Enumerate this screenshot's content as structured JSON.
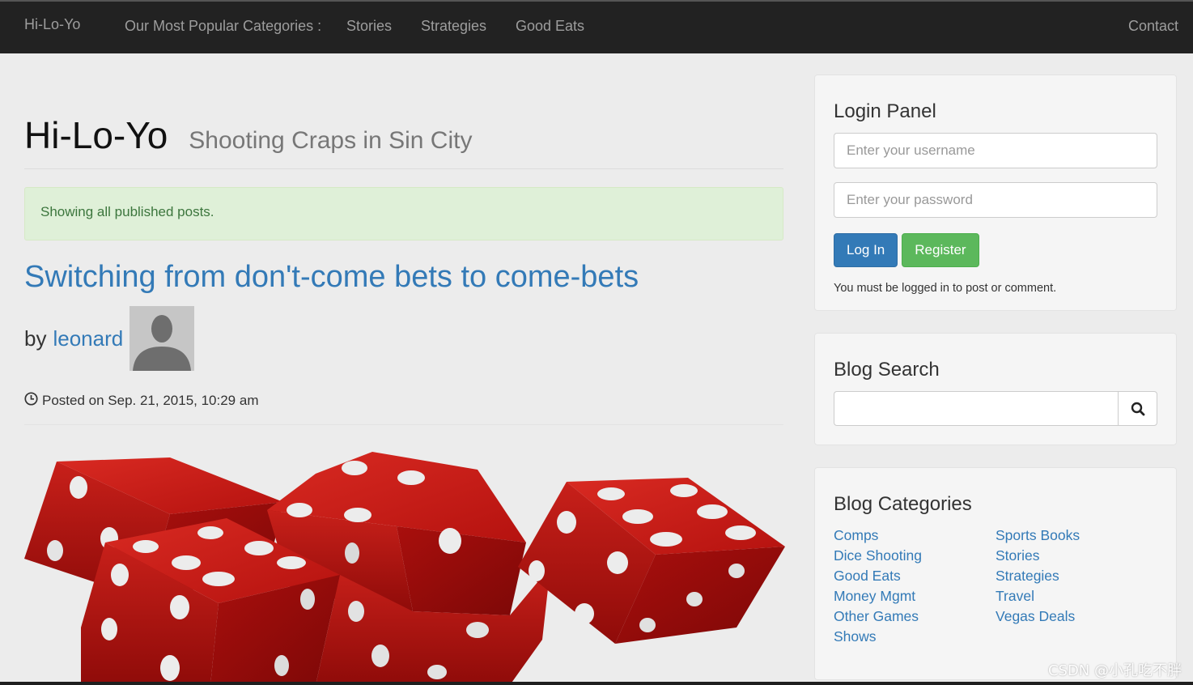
{
  "navbar": {
    "brand": "Hi-Lo-Yo",
    "categories_label": "Our Most Popular Categories :",
    "links": [
      "Stories",
      "Strategies",
      "Good Eats"
    ],
    "contact": "Contact"
  },
  "header": {
    "title": "Hi-Lo-Yo",
    "subtitle": "Shooting Craps in Sin City"
  },
  "alert": "Showing all published posts.",
  "post": {
    "title": "Switching from don't-come bets to come-bets",
    "by": "by",
    "author": "leonard",
    "posted": "Posted on Sep. 21, 2015, 10:29 am"
  },
  "login_panel": {
    "title": "Login Panel",
    "username_placeholder": "Enter your username",
    "password_placeholder": "Enter your password",
    "login_label": "Log In",
    "register_label": "Register",
    "note": "You must be logged in to post or comment."
  },
  "blog_search": {
    "title": "Blog Search"
  },
  "blog_categories": {
    "title": "Blog Categories",
    "left": [
      "Comps",
      "Dice Shooting",
      "Good Eats",
      "Money Mgmt",
      "Other Games",
      "Shows"
    ],
    "right": [
      "Sports Books",
      "Stories",
      "Strategies",
      "Travel",
      "Vegas Deals"
    ]
  },
  "watermark": "CSDN @小孔吃不胖",
  "colors": {
    "navbar_bg": "#222222",
    "link": "#337ab7",
    "primary_button": "#337ab7",
    "success_button": "#5cb85c",
    "alert_bg": "#dff0d8",
    "dice_red": "#c41a1a"
  }
}
